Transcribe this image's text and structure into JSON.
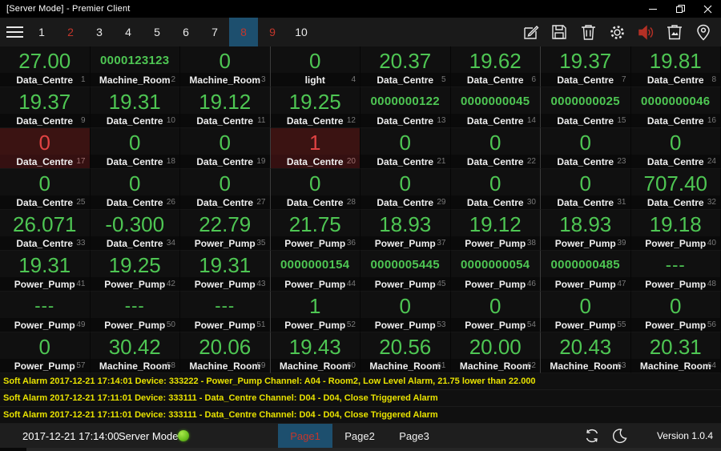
{
  "window": {
    "title": "[Server Mode] - Premier Client"
  },
  "colors": {
    "accent_blue": "#1d4f6e",
    "value_green": "#4ec653",
    "value_red": "#e04343",
    "alarm_tile_bg": "#3b1312",
    "alarm_text_yellow": "#e8e200",
    "tab_alert_red": "#c3362b",
    "status_dot_green": "#6abf1e"
  },
  "toolbar": {
    "tabs": [
      {
        "label": "1",
        "state": "normal"
      },
      {
        "label": "2",
        "state": "alert"
      },
      {
        "label": "3",
        "state": "normal"
      },
      {
        "label": "4",
        "state": "normal"
      },
      {
        "label": "5",
        "state": "normal"
      },
      {
        "label": "6",
        "state": "normal"
      },
      {
        "label": "7",
        "state": "normal"
      },
      {
        "label": "8",
        "state": "selected"
      },
      {
        "label": "9",
        "state": "alert"
      },
      {
        "label": "10",
        "state": "normal"
      }
    ],
    "icons": [
      "menu-icon",
      "edit-icon",
      "save-icon",
      "delete-icon",
      "settings-icon",
      "sound-on-icon",
      "image-bin-icon",
      "location-icon"
    ]
  },
  "grid": {
    "columns": 8,
    "tiles": [
      {
        "value": "27.00",
        "label": "Data_Centre",
        "index": 1,
        "alarm": false
      },
      {
        "value": "0000123123",
        "label": "Machine_Room",
        "index": 2,
        "alarm": false
      },
      {
        "value": "0",
        "label": "Machine_Room",
        "index": 3,
        "alarm": false
      },
      {
        "value": "0",
        "label": "light",
        "index": 4,
        "alarm": false
      },
      {
        "value": "20.37",
        "label": "Data_Centre",
        "index": 5,
        "alarm": false
      },
      {
        "value": "19.62",
        "label": "Data_Centre",
        "index": 6,
        "alarm": false
      },
      {
        "value": "19.37",
        "label": "Data_Centre",
        "index": 7,
        "alarm": false
      },
      {
        "value": "19.81",
        "label": "Data_Centre",
        "index": 8,
        "alarm": false
      },
      {
        "value": "19.37",
        "label": "Data_Centre",
        "index": 9,
        "alarm": false
      },
      {
        "value": "19.31",
        "label": "Data_Centre",
        "index": 10,
        "alarm": false
      },
      {
        "value": "19.12",
        "label": "Data_Centre",
        "index": 11,
        "alarm": false
      },
      {
        "value": "19.25",
        "label": "Data_Centre",
        "index": 12,
        "alarm": false
      },
      {
        "value": "0000000122",
        "label": "Data_Centre",
        "index": 13,
        "alarm": false
      },
      {
        "value": "0000000045",
        "label": "Data_Centre",
        "index": 14,
        "alarm": false
      },
      {
        "value": "0000000025",
        "label": "Data_Centre",
        "index": 15,
        "alarm": false
      },
      {
        "value": "0000000046",
        "label": "Data_Centre",
        "index": 16,
        "alarm": false
      },
      {
        "value": "0",
        "label": "Data_Centre",
        "index": 17,
        "alarm": true
      },
      {
        "value": "0",
        "label": "Data_Centre",
        "index": 18,
        "alarm": false
      },
      {
        "value": "0",
        "label": "Data_Centre",
        "index": 19,
        "alarm": false
      },
      {
        "value": "1",
        "label": "Data_Centre",
        "index": 20,
        "alarm": true
      },
      {
        "value": "0",
        "label": "Data_Centre",
        "index": 21,
        "alarm": false
      },
      {
        "value": "0",
        "label": "Data_Centre",
        "index": 22,
        "alarm": false
      },
      {
        "value": "0",
        "label": "Data_Centre",
        "index": 23,
        "alarm": false
      },
      {
        "value": "0",
        "label": "Data_Centre",
        "index": 24,
        "alarm": false
      },
      {
        "value": "0",
        "label": "Data_Centre",
        "index": 25,
        "alarm": false
      },
      {
        "value": "0",
        "label": "Data_Centre",
        "index": 26,
        "alarm": false
      },
      {
        "value": "0",
        "label": "Data_Centre",
        "index": 27,
        "alarm": false
      },
      {
        "value": "0",
        "label": "Data_Centre",
        "index": 28,
        "alarm": false
      },
      {
        "value": "0",
        "label": "Data_Centre",
        "index": 29,
        "alarm": false
      },
      {
        "value": "0",
        "label": "Data_Centre",
        "index": 30,
        "alarm": false
      },
      {
        "value": "0",
        "label": "Data_Centre",
        "index": 31,
        "alarm": false
      },
      {
        "value": "707.40",
        "label": "Data_Centre",
        "index": 32,
        "alarm": false
      },
      {
        "value": "26.071",
        "label": "Data_Centre",
        "index": 33,
        "alarm": false
      },
      {
        "value": "-0.300",
        "label": "Data_Centre",
        "index": 34,
        "alarm": false
      },
      {
        "value": "22.79",
        "label": "Power_Pump",
        "index": 35,
        "alarm": false
      },
      {
        "value": "21.75",
        "label": "Power_Pump",
        "index": 36,
        "alarm": false
      },
      {
        "value": "18.93",
        "label": "Power_Pump",
        "index": 37,
        "alarm": false
      },
      {
        "value": "19.12",
        "label": "Power_Pump",
        "index": 38,
        "alarm": false
      },
      {
        "value": "18.93",
        "label": "Power_Pump",
        "index": 39,
        "alarm": false
      },
      {
        "value": "19.18",
        "label": "Power_Pump",
        "index": 40,
        "alarm": false
      },
      {
        "value": "19.31",
        "label": "Power_Pump",
        "index": 41,
        "alarm": false
      },
      {
        "value": "19.25",
        "label": "Power_Pump",
        "index": 42,
        "alarm": false
      },
      {
        "value": "19.31",
        "label": "Power_Pump",
        "index": 43,
        "alarm": false
      },
      {
        "value": "0000000154",
        "label": "Power_Pump",
        "index": 44,
        "alarm": false
      },
      {
        "value": "0000005445",
        "label": "Power_Pump",
        "index": 45,
        "alarm": false
      },
      {
        "value": "0000000054",
        "label": "Power_Pump",
        "index": 46,
        "alarm": false
      },
      {
        "value": "0000000485",
        "label": "Power_Pump",
        "index": 47,
        "alarm": false
      },
      {
        "value": "---",
        "label": "Power_Pump",
        "index": 48,
        "alarm": false
      },
      {
        "value": "---",
        "label": "Power_Pump",
        "index": 49,
        "alarm": false
      },
      {
        "value": "---",
        "label": "Power_Pump",
        "index": 50,
        "alarm": false
      },
      {
        "value": "---",
        "label": "Power_Pump",
        "index": 51,
        "alarm": false
      },
      {
        "value": "1",
        "label": "Power_Pump",
        "index": 52,
        "alarm": false
      },
      {
        "value": "0",
        "label": "Power_Pump",
        "index": 53,
        "alarm": false
      },
      {
        "value": "0",
        "label": "Power_Pump",
        "index": 54,
        "alarm": false
      },
      {
        "value": "0",
        "label": "Power_Pump",
        "index": 55,
        "alarm": false
      },
      {
        "value": "0",
        "label": "Power_Pump",
        "index": 56,
        "alarm": false
      },
      {
        "value": "0",
        "label": "Power_Pump",
        "index": 57,
        "alarm": false
      },
      {
        "value": "30.42",
        "label": "Machine_Room",
        "index": 58,
        "alarm": false
      },
      {
        "value": "20.06",
        "label": "Machine_Room",
        "index": 59,
        "alarm": false
      },
      {
        "value": "19.43",
        "label": "Machine_Room",
        "index": 60,
        "alarm": false
      },
      {
        "value": "20.56",
        "label": "Machine_Room",
        "index": 61,
        "alarm": false
      },
      {
        "value": "20.00",
        "label": "Machine_Room",
        "index": 62,
        "alarm": false
      },
      {
        "value": "20.43",
        "label": "Machine_Room",
        "index": 63,
        "alarm": false
      },
      {
        "value": "20.31",
        "label": "Machine_Room",
        "index": 64,
        "alarm": false
      }
    ]
  },
  "alarms": [
    "Soft Alarm 2017-12-21 17:14:01 Device: 333222 - Power_Pump Channel: A04 - Room2, Low Level Alarm, 21.75 lower than 22.000",
    "Soft Alarm 2017-12-21 17:11:01 Device: 333111 - Data_Centre Channel: D04 - D04, Close Triggered Alarm",
    "Soft Alarm 2017-12-21 17:11:01 Device: 333111 - Data_Centre Channel: D04 - D04, Close Triggered Alarm"
  ],
  "statusbar": {
    "timestamp": "2017-12-21 17:14:00",
    "mode_label": "Server Mode",
    "pages": [
      {
        "label": "Page1",
        "selected": true
      },
      {
        "label": "Page2",
        "selected": false
      },
      {
        "label": "Page3",
        "selected": false
      }
    ],
    "icons": [
      "sync-icon",
      "dark-mode-icon"
    ],
    "version": "Version 1.0.4"
  }
}
